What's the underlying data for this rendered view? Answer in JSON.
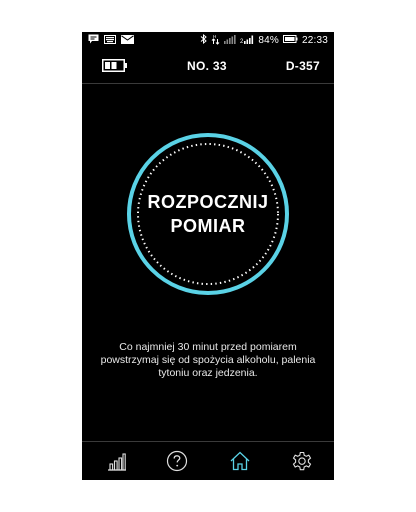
{
  "status_bar": {
    "battery_percent": "84%",
    "time": "22:33",
    "left_icons": [
      "chat-icon",
      "keyboard-icon",
      "mail-icon"
    ],
    "right_icons": [
      "bluetooth-icon",
      "data-transfer-icon",
      "signal-icon",
      "signal-icon",
      "battery-icon"
    ]
  },
  "header": {
    "device_no": "NO. 33",
    "device_id": "D-357",
    "battery_icon": "battery-level-icon"
  },
  "start": {
    "label_line1": "ROZPOCZNIJ",
    "label_line2": "POMIAR"
  },
  "info": {
    "line1": "Co najmniej 30 minut przed pomiarem",
    "line2": "powstrzymaj się od spożycia alkoholu, palenia",
    "line3": "tytoniu oraz jedzenia."
  },
  "nav": {
    "items": [
      {
        "icon": "bar-chart-icon",
        "active": false
      },
      {
        "icon": "help-icon",
        "active": false
      },
      {
        "icon": "home-icon",
        "active": true
      },
      {
        "icon": "settings-icon",
        "active": false
      }
    ]
  },
  "colors": {
    "accent": "#5ad2e6",
    "background": "#000000",
    "text": "#ffffff"
  }
}
